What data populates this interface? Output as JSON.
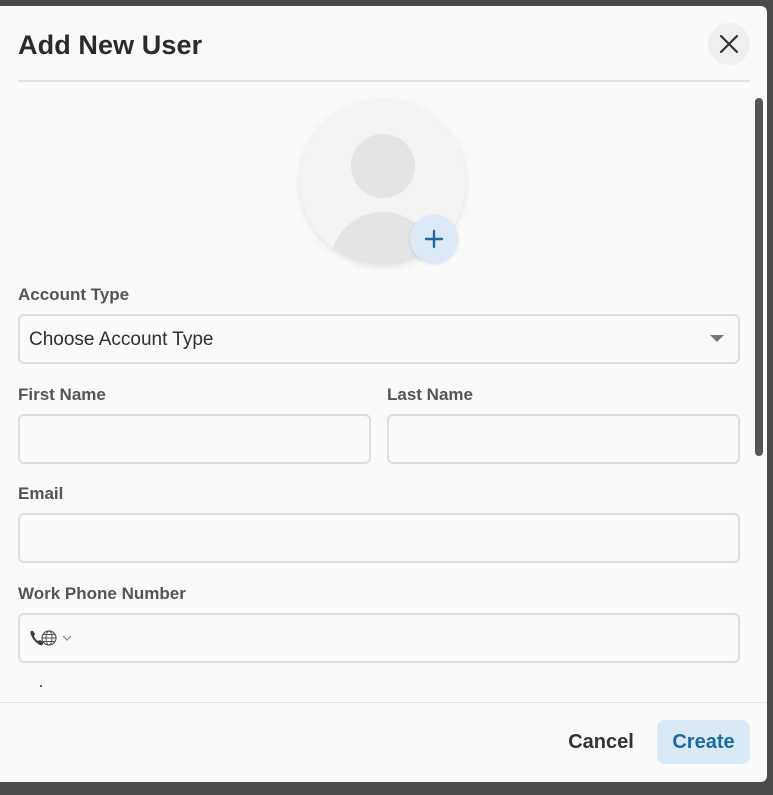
{
  "dialog": {
    "title": "Add New User"
  },
  "form": {
    "account_type": {
      "label": "Account Type",
      "value": "Choose Account Type"
    },
    "first_name": {
      "label": "First Name",
      "value": ""
    },
    "last_name": {
      "label": "Last Name",
      "value": ""
    },
    "email": {
      "label": "Email",
      "value": ""
    },
    "work_phone": {
      "label": "Work Phone Number",
      "value": ""
    }
  },
  "footer": {
    "cancel_label": "Cancel",
    "create_label": "Create"
  },
  "icons": {
    "close": "close-icon",
    "add_photo": "plus-icon",
    "phone": "phone-globe-icon",
    "dropdown": "caret-down-icon"
  },
  "colors": {
    "accent": "#1e6aa0",
    "accent_bg": "#d9e9f6"
  }
}
